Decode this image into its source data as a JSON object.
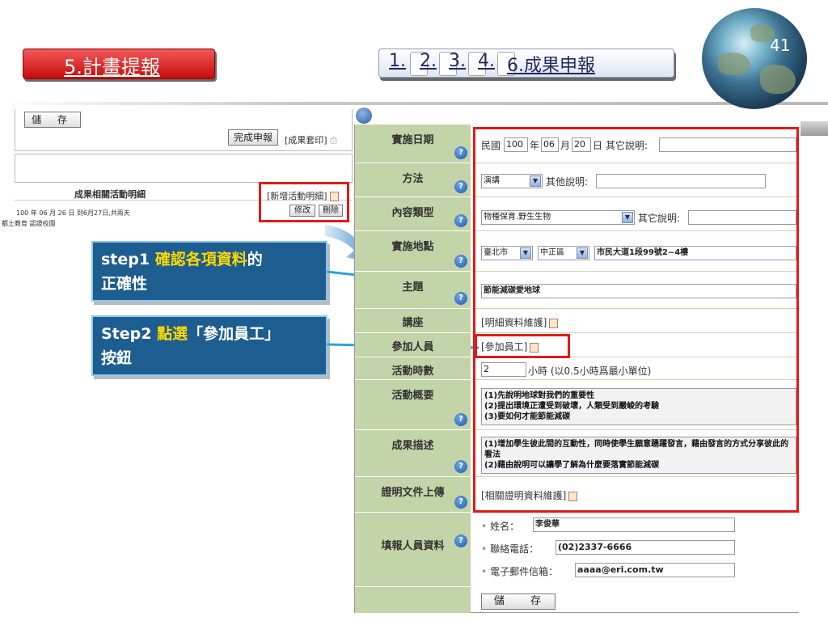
{
  "slide_number": "41",
  "left_tab": {
    "label": "5.計畫提報"
  },
  "right_tabs": {
    "items": [
      "1.",
      "2.",
      "3.",
      "4."
    ],
    "active": "6.成果申報"
  },
  "left_panel": {
    "save_label": "儲 存",
    "complete_label": "完成申報",
    "set_print_label": "[成果套印]",
    "list_header": "成果相關活動明細",
    "add_detail_label": "[新增活動明細]",
    "activity_line": "100 年 06 月 26 日 到6月27日,共兩天",
    "activity_place": "都土教育 認證校園",
    "edit_label": "修改",
    "delete_label": "刪除"
  },
  "callouts": {
    "step1_prefix": "step1 ",
    "step1_highlight": "確認各項資料",
    "step1_suffix": "的",
    "step1_line2": "正確性",
    "step2_prefix": "Step2 ",
    "step2_highlight": "點選",
    "step2_suffix": "「參加員工」",
    "step2_line2": "按鈕"
  },
  "form": {
    "labels": {
      "date": "實施日期",
      "method": "方法",
      "content_type": "內容類型",
      "place": "實施地點",
      "topic": "主題",
      "lecture": "講座",
      "participants": "參加人員",
      "hours": "活動時數",
      "summary": "活動概要",
      "result": "成果描述",
      "proof": "證明文件上傳",
      "reporter": "填報人員資料"
    },
    "date": {
      "prefix": "民國",
      "year": "100",
      "year_unit": "年",
      "month": "06",
      "month_unit": "月",
      "day": "20",
      "day_unit": "日",
      "other": "其它說明:"
    },
    "method": {
      "value": "演講",
      "other": "其他說明:"
    },
    "content_type": {
      "value": "物種保育.野生生物",
      "other": "其它說明:"
    },
    "place": {
      "city": "臺北市",
      "district": "中正區",
      "address": "市民大道1段99號2~4樓"
    },
    "topic": {
      "value": "節能減碳愛地球"
    },
    "lecture": {
      "link": "[明細資料維護]"
    },
    "participants": {
      "link": "[參加員工]"
    },
    "hours": {
      "value": "2",
      "suffix": "小時 (以0.5小時爲最小單位)"
    },
    "summary": {
      "lines": [
        "(1)先說明地球對我們的重要性",
        "(2)提出環境正遭受到破壞，人類受到嚴峻的考驗",
        "(3)要如何才能節能減碳"
      ]
    },
    "result": {
      "lines": [
        "(1)增加學生彼此間的互動性，同時使學生願意踴躍發言，藉由發言的方式分享彼此的看法",
        "(2)藉由說明可以讓學了解為什麼要落實節能減碳"
      ]
    },
    "proof": {
      "link": "[相關證明資料維護]"
    },
    "reporter": {
      "name_label": "姓名：",
      "name": "李俊華",
      "phone_label": "聯絡電話：",
      "phone": "(02)2337-6666",
      "email_label": "電子郵件信箱：",
      "email": "aaaa@eri.com.tw"
    },
    "save_label": "儲 存"
  },
  "colors": {
    "highlight_red": "#e01a1a",
    "callout_blue": "#1d5d8f",
    "label_green": "#c2d4a8",
    "callout_yellow": "#ffd700"
  }
}
